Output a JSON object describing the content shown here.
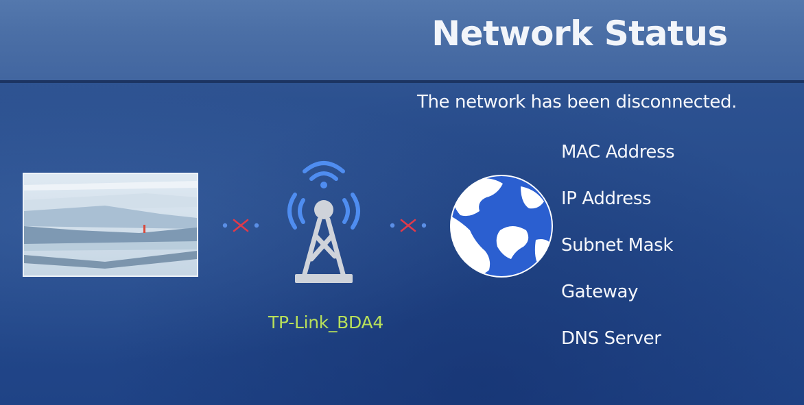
{
  "screen": {
    "title": "Network Status",
    "status_message": "The network has been disconnected."
  },
  "diagram": {
    "tv_icon": "tv-screen-icon",
    "router_icon": "wifi-router-tower-icon",
    "internet_icon": "globe-icon",
    "ssid": "TP-Link_BDA4",
    "tv_to_router_link": "disconnected",
    "router_to_internet_link": "disconnected"
  },
  "info_labels": [
    "MAC Address",
    "IP Address",
    "Subnet Mask",
    "Gateway",
    "DNS Server"
  ],
  "colors": {
    "background": "#2c5190",
    "ssid_text": "#b8e05a",
    "disconnect_x": "#e03a4a",
    "globe_land": "#ffffff",
    "globe_water": "#2b5fd0"
  }
}
